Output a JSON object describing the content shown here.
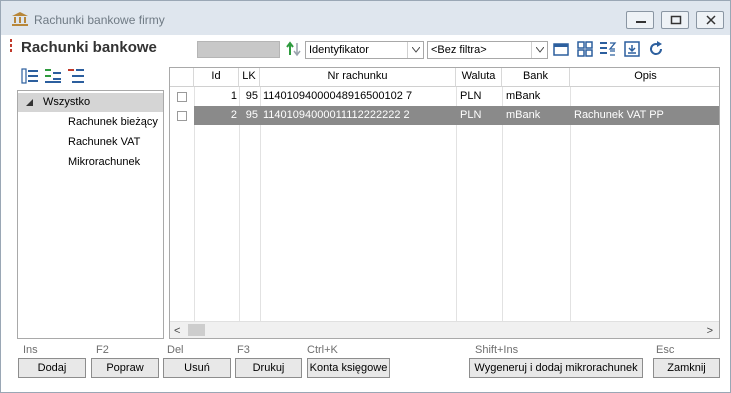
{
  "window": {
    "title": "Rachunki bankowe firmy"
  },
  "page": {
    "title": "Rachunki bankowe"
  },
  "toolbar": {
    "search_value": "",
    "sort_field": "Identyfikator",
    "filter": "<Bez filtra>"
  },
  "tree": {
    "root": "Wszystko",
    "items": [
      "Rachunek bieżący",
      "Rachunek VAT",
      "Mikrorachunek"
    ]
  },
  "grid": {
    "columns": [
      "Id",
      "LK",
      "Nr rachunku",
      "Waluta",
      "Bank",
      "Opis"
    ],
    "rows": [
      {
        "id": "1",
        "lk": "95",
        "nr": "11401094000048916500102 7",
        "waluta": "PLN",
        "bank": "mBank",
        "opis": ""
      },
      {
        "id": "2",
        "lk": "95",
        "nr": "11401094000011112222222 2",
        "waluta": "PLN",
        "bank": "mBank",
        "opis": "Rachunek VAT PP"
      }
    ],
    "selected_row": 2
  },
  "hotkeys": {
    "dodaj": "Ins",
    "popraw": "F2",
    "usun": "Del",
    "drukuj": "F3",
    "konta": "Ctrl+K",
    "wygeneruj": "Shift+Ins",
    "zamknij": "Esc"
  },
  "buttons": {
    "dodaj": "Dodaj",
    "popraw": "Popraw",
    "usun": "Usuń",
    "drukuj": "Drukuj",
    "konta": "Konta księgowe",
    "wygeneruj": "Wygeneruj i dodaj mikrorachunek",
    "zamknij": "Zamknij"
  },
  "colors": {
    "accent": "#c0392b",
    "selected_row": "#8a8a8a",
    "titlebar": "#dfe6ee"
  }
}
